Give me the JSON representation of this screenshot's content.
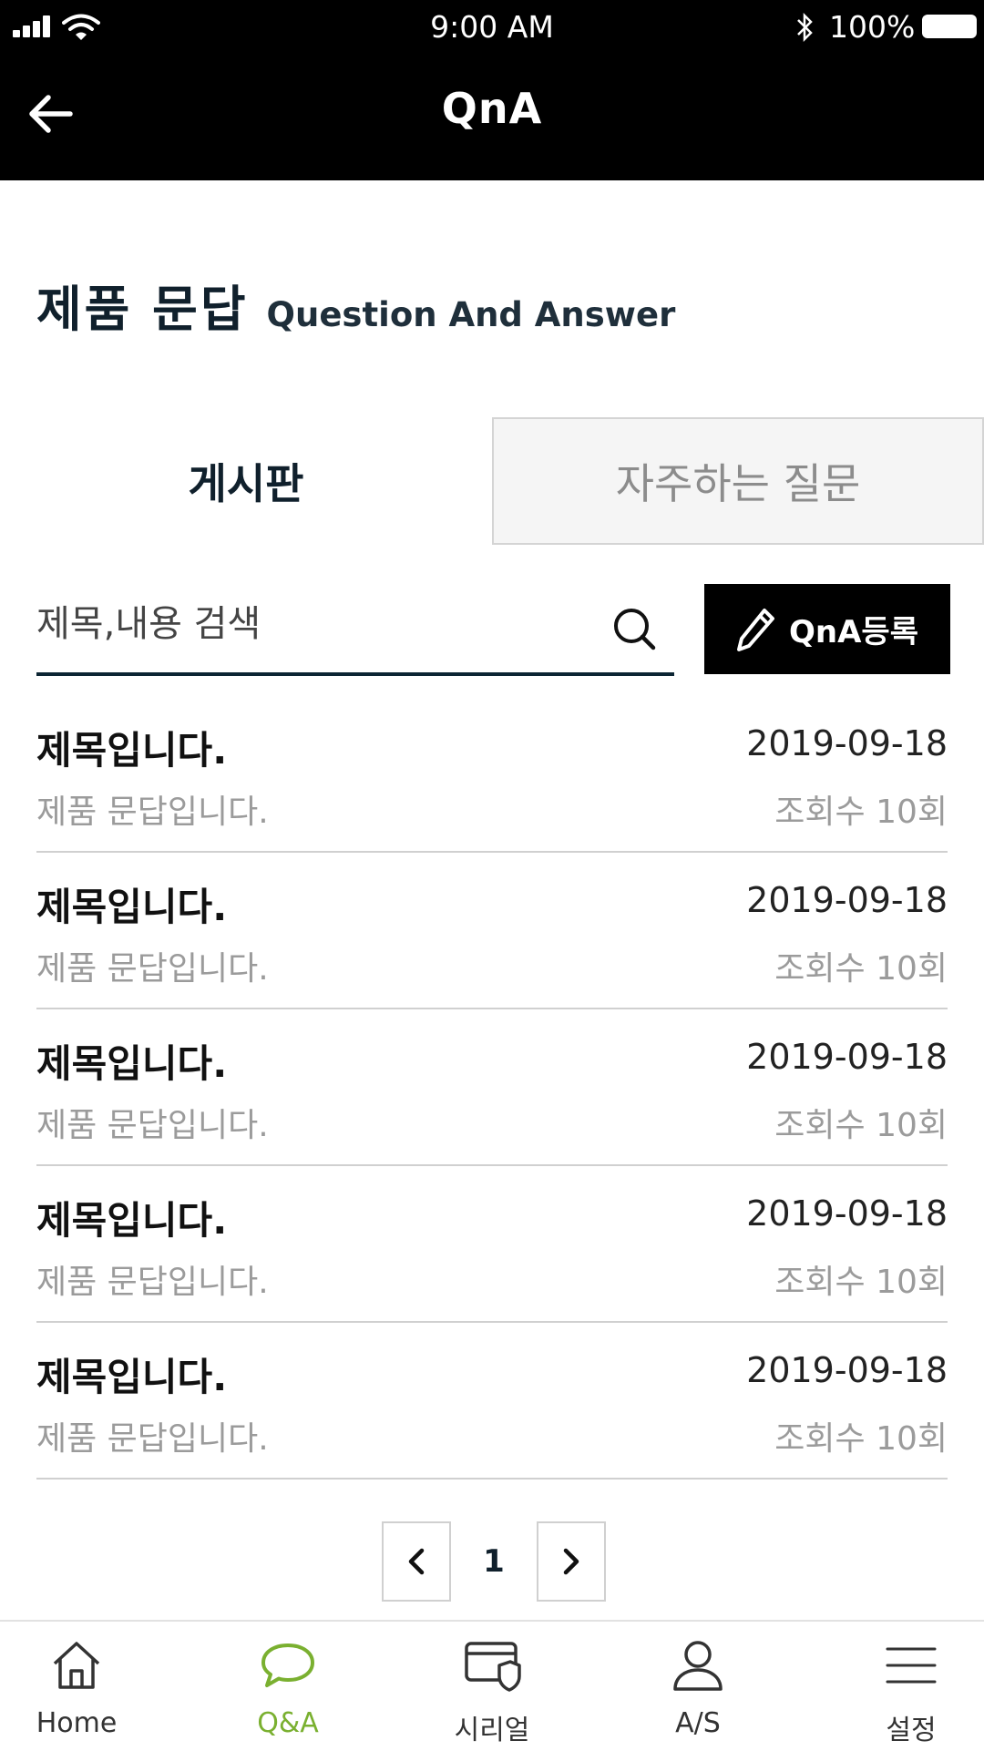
{
  "status_bar": {
    "time": "9:00 AM",
    "battery": "100%"
  },
  "header": {
    "title": "QnA",
    "back_icon": "arrow-left-icon"
  },
  "section": {
    "title_ko": "제품 문답",
    "title_en": "Question And Answer"
  },
  "tabs": [
    {
      "label": "게시판",
      "active": true
    },
    {
      "label": "자주하는 질문",
      "active": false
    }
  ],
  "search": {
    "placeholder": "제목,내용 검색",
    "value": "",
    "icon": "search-icon"
  },
  "register_button": {
    "label": "QnA등록",
    "icon": "pencil-icon"
  },
  "posts": [
    {
      "title": "제목입니다.",
      "date": "2019-09-18",
      "body": "제품 문답입니다.",
      "views": "조회수 10회"
    },
    {
      "title": "제목입니다.",
      "date": "2019-09-18",
      "body": "제품 문답입니다.",
      "views": "조회수 10회"
    },
    {
      "title": "제목입니다.",
      "date": "2019-09-18",
      "body": "제품 문답입니다.",
      "views": "조회수 10회"
    },
    {
      "title": "제목입니다.",
      "date": "2019-09-18",
      "body": "제품 문답입니다.",
      "views": "조회수 10회"
    },
    {
      "title": "제목입니다.",
      "date": "2019-09-18",
      "body": "제품 문답입니다.",
      "views": "조회수 10회"
    }
  ],
  "pagination": {
    "current_page": "1",
    "prev_icon": "chevron-left-icon",
    "next_icon": "chevron-right-icon"
  },
  "bottom_nav": [
    {
      "label": "Home",
      "icon": "home-icon",
      "active": false
    },
    {
      "label": "Q&A",
      "icon": "chat-bubble-icon",
      "active": true
    },
    {
      "label": "시리얼",
      "icon": "card-shield-icon",
      "active": false
    },
    {
      "label": "A/S",
      "icon": "user-icon",
      "active": false
    },
    {
      "label": "설정",
      "icon": "menu-icon",
      "active": false
    }
  ],
  "colors": {
    "header_bg": "#000000",
    "accent_green": "#7ab030",
    "title_navy": "#10202c",
    "muted_gray": "#9b9b9b"
  }
}
